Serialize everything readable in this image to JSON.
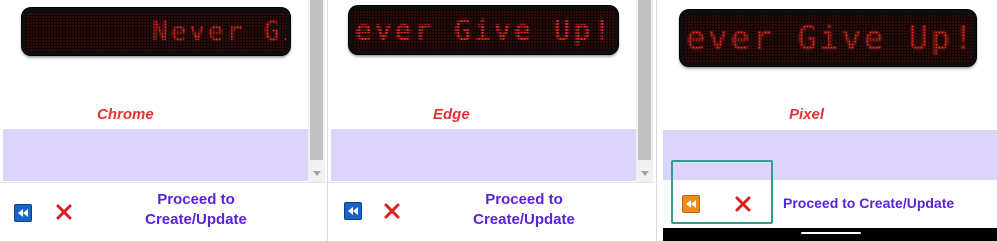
{
  "ticker_text": "Never Give Up!",
  "panels": {
    "chrome": {
      "label": "Chrome",
      "visible_text": "Never Gi",
      "proceed_line1": "Proceed to",
      "proceed_line2": "Create/Update"
    },
    "edge": {
      "label": "Edge",
      "visible_text": "ever Give Up!",
      "proceed_line1": "Proceed to",
      "proceed_line2": "Create/Update"
    },
    "pixel": {
      "label": "Pixel",
      "visible_text": "ever Give Up!",
      "proceed": "Proceed to Create/Update"
    }
  },
  "icons": {
    "rewind": "rewind-icon",
    "close": "close-icon"
  },
  "colors": {
    "led_on": "#ff2a1c",
    "led_off": "#2e0c0c",
    "label": "#e53333",
    "band": "#ddd4fb",
    "proceed": "#5b22d8",
    "rewind_blue": "#1a63c8",
    "rewind_orange": "#ee8a1b",
    "close_red": "#e01d1d",
    "highlight": "#2f9e8f"
  }
}
